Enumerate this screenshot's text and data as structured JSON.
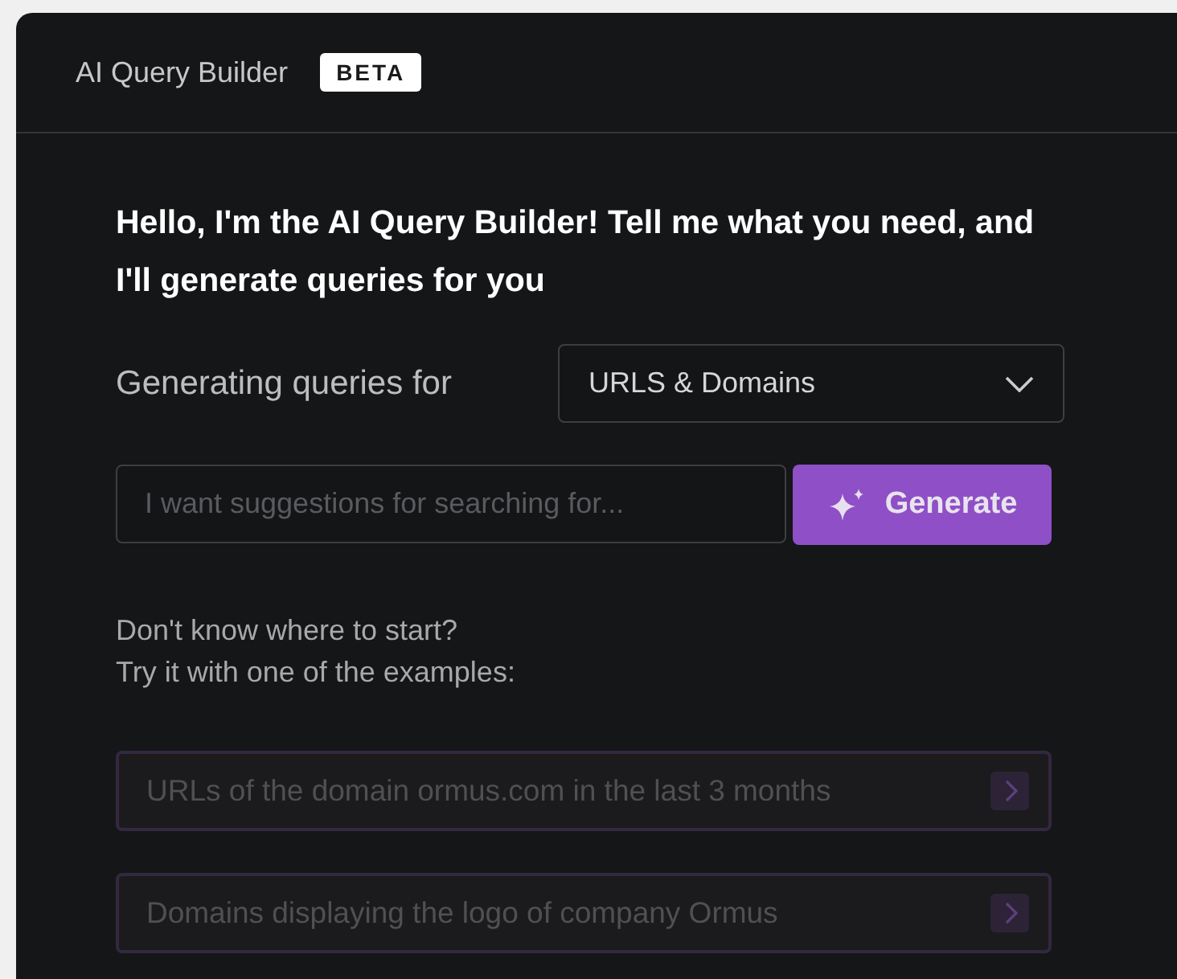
{
  "window": {
    "title": "AI Query Builder",
    "badge": "BETA"
  },
  "intro": "Hello, I'm the AI Query Builder! Tell me what you need, and I'll generate queries for you",
  "target": {
    "label": "Generating queries for",
    "value": "URLS & Domains"
  },
  "prompt": {
    "placeholder": "I want suggestions for searching for...",
    "button": "Generate"
  },
  "help": [
    "Don't know where to start?",
    "Try it with one of the examples:"
  ],
  "examples": [
    "URLs of the domain ormus.com in the last 3 months",
    "Domains displaying the logo of company Ormus"
  ]
}
